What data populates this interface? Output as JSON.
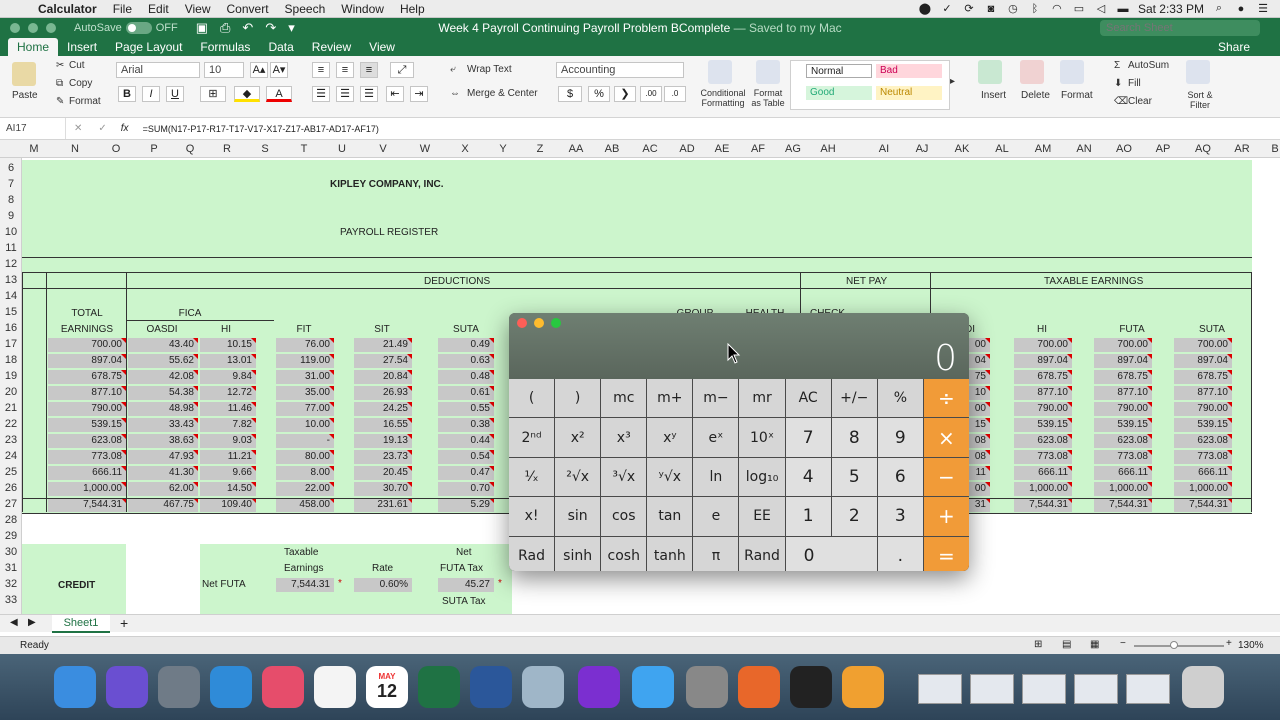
{
  "menubar": {
    "app": "Calculator",
    "items": [
      "File",
      "Edit",
      "View",
      "Convert",
      "Speech",
      "Window",
      "Help"
    ],
    "time": "Sat 2:33 PM"
  },
  "titlebar": {
    "autosave": "AutoSave",
    "autosave_state": "OFF",
    "title": "Week 4 Payroll Continuing Payroll Problem BComplete",
    "saved": "— Saved to my Mac",
    "search_placeholder": "Search Sheet"
  },
  "tabs": [
    "Home",
    "Insert",
    "Page Layout",
    "Formulas",
    "Data",
    "Review",
    "View"
  ],
  "share": "Share",
  "ribbon": {
    "paste": "Paste",
    "cut": "Cut",
    "copy": "Copy",
    "format": "Format",
    "font": "Arial",
    "size": "10",
    "bold": "B",
    "italic": "I",
    "underline": "U",
    "wrap": "Wrap Text",
    "merge": "Merge & Center",
    "numfmt": "Accounting",
    "dollar": "$",
    "percent": "%",
    "comma": "❯",
    "cond": "Conditional Formatting",
    "fmt_table": "Format as Table",
    "styles": [
      {
        "label": "Normal",
        "bg": "#ffffff",
        "fg": "#333333"
      },
      {
        "label": "Bad",
        "bg": "#ffc7ce",
        "fg": "#9c0006"
      },
      {
        "label": "Good",
        "bg": "#c6efce",
        "fg": "#006100"
      },
      {
        "label": "Neutral",
        "bg": "#ffeb9c",
        "fg": "#9c5700"
      }
    ],
    "insert": "Insert",
    "delete": "Delete",
    "format_cells": "Format",
    "autosum": "AutoSum",
    "fill": "Fill",
    "clear": "Clear",
    "sort": "Sort & Filter"
  },
  "formula": {
    "namebox": "AI17",
    "fx": "fx",
    "content": "=SUM(N17-P17-R17-T17-V17-X17-Z17-AB17-AD17-AF17)"
  },
  "columns": [
    "M",
    "N",
    "O",
    "P",
    "Q",
    "R",
    "S",
    "T",
    "U",
    "V",
    "W",
    "X",
    "Y",
    "Z",
    "AA",
    "AB",
    "AC",
    "AD",
    "AE",
    "AF",
    "AG",
    "AH",
    "AI",
    "AJ",
    "AK",
    "AL",
    "AM",
    "AN",
    "AO",
    "AP",
    "AQ",
    "AR",
    "B"
  ],
  "rows": [
    "6",
    "7",
    "8",
    "9",
    "10",
    "11",
    "12",
    "13",
    "14",
    "15",
    "16",
    "17",
    "18",
    "19",
    "20",
    "21",
    "22",
    "23",
    "24",
    "25",
    "26",
    "27",
    "28",
    "29",
    "30",
    "31",
    "32",
    "33"
  ],
  "sheet": {
    "company": "KIPLEY COMPANY, INC.",
    "register": "PAYROLL REGISTER",
    "deductions": "DEDUCTIONS",
    "netpay": "NET PAY",
    "taxable": "TAXABLE EARNINGS",
    "total": "TOTAL",
    "earnings": "EARNINGS",
    "fica": "FICA",
    "oasdi": "OASDI",
    "hi": "HI",
    "fit": "FIT",
    "sit": "SIT",
    "suta": "SUTA",
    "group": "GROUP",
    "health": "HEALTH",
    "check": "CHECK",
    "t_di": "DI",
    "t_hi": "HI",
    "t_futa": "FUTA",
    "t_suta": "SUTA",
    "total_earnings": [
      "700.00",
      "897.04",
      "678.75",
      "877.10",
      "790.00",
      "539.15",
      "623.08",
      "773.08",
      "666.11",
      "1,000.00",
      "7,544.31"
    ],
    "oasdi_vals": [
      "43.40",
      "55.62",
      "42.08",
      "54.38",
      "48.98",
      "33.43",
      "38.63",
      "47.93",
      "41.30",
      "62.00",
      "467.75"
    ],
    "hi_vals": [
      "10.15",
      "13.01",
      "9.84",
      "12.72",
      "11.46",
      "7.82",
      "9.03",
      "11.21",
      "9.66",
      "14.50",
      "109.40"
    ],
    "fit_vals": [
      "76.00",
      "119.00",
      "31.00",
      "35.00",
      "77.00",
      "10.00",
      "-",
      "80.00",
      "8.00",
      "22.00",
      "458.00"
    ],
    "sit_vals": [
      "21.49",
      "27.54",
      "20.84",
      "26.93",
      "24.25",
      "16.55",
      "19.13",
      "23.73",
      "20.45",
      "30.70",
      "231.61"
    ],
    "suta_vals": [
      "0.49",
      "0.63",
      "0.48",
      "0.61",
      "0.55",
      "0.38",
      "0.44",
      "0.54",
      "0.47",
      "0.70",
      "5.29"
    ],
    "ak_vals": [
      "00",
      "04",
      "75",
      "10",
      "00",
      "15",
      "08",
      "08",
      "11",
      "00",
      "31"
    ],
    "tax_hi": [
      "700.00",
      "897.04",
      "678.75",
      "877.10",
      "790.00",
      "539.15",
      "623.08",
      "773.08",
      "666.11",
      "1,000.00",
      "7,544.31"
    ],
    "tax_futa": [
      "700.00",
      "897.04",
      "678.75",
      "877.10",
      "790.00",
      "539.15",
      "623.08",
      "773.08",
      "666.11",
      "1,000.00",
      "7,544.31"
    ],
    "tax_suta": [
      "700.00",
      "897.04",
      "678.75",
      "877.10",
      "790.00",
      "539.15",
      "623.08",
      "773.08",
      "666.11",
      "1,000.00",
      "7,544.31"
    ],
    "taxable_l1": "Taxable",
    "taxable_l2": "Earnings",
    "rate": "Rate",
    "net_l1": "Net",
    "net_l2": "FUTA Tax",
    "suta_tax": "SUTA Tax",
    "credit": "CREDIT",
    "net_futa": "Net FUTA",
    "nf_earn": "7,544.31",
    "nf_rate": "0.60%",
    "nf_tax": "45.27",
    "star": "*"
  },
  "sheet_tab": "Sheet1",
  "status": "Ready",
  "zoom": "130%",
  "calculator": {
    "display": "0",
    "keys": [
      "(",
      ")",
      "mc",
      "m+",
      "m−",
      "mr",
      "AC",
      "+/−",
      "%",
      "÷",
      "2ⁿᵈ",
      "x²",
      "x³",
      "xʸ",
      "eˣ",
      "10ˣ",
      "7",
      "8",
      "9",
      "×",
      "¹⁄ₓ",
      "²√x",
      "³√x",
      "ʸ√x",
      "ln",
      "log₁₀",
      "4",
      "5",
      "6",
      "−",
      "x!",
      "sin",
      "cos",
      "tan",
      "e",
      "EE",
      "1",
      "2",
      "3",
      "+",
      "Rad",
      "sinh",
      "cosh",
      "tanh",
      "π",
      "Rand",
      "0",
      ".",
      "="
    ]
  },
  "dock": [
    "Finder",
    "Siri",
    "Launchpad",
    "Safari",
    "iTunes",
    "Reminders",
    "Calendar",
    "Excel",
    "Word",
    "Preview",
    "Yahoo",
    "Messages",
    "Calculator",
    "Firefox",
    "Keychain",
    "Pages",
    "Trash"
  ],
  "dock_date": "12",
  "dock_month": "MAY"
}
